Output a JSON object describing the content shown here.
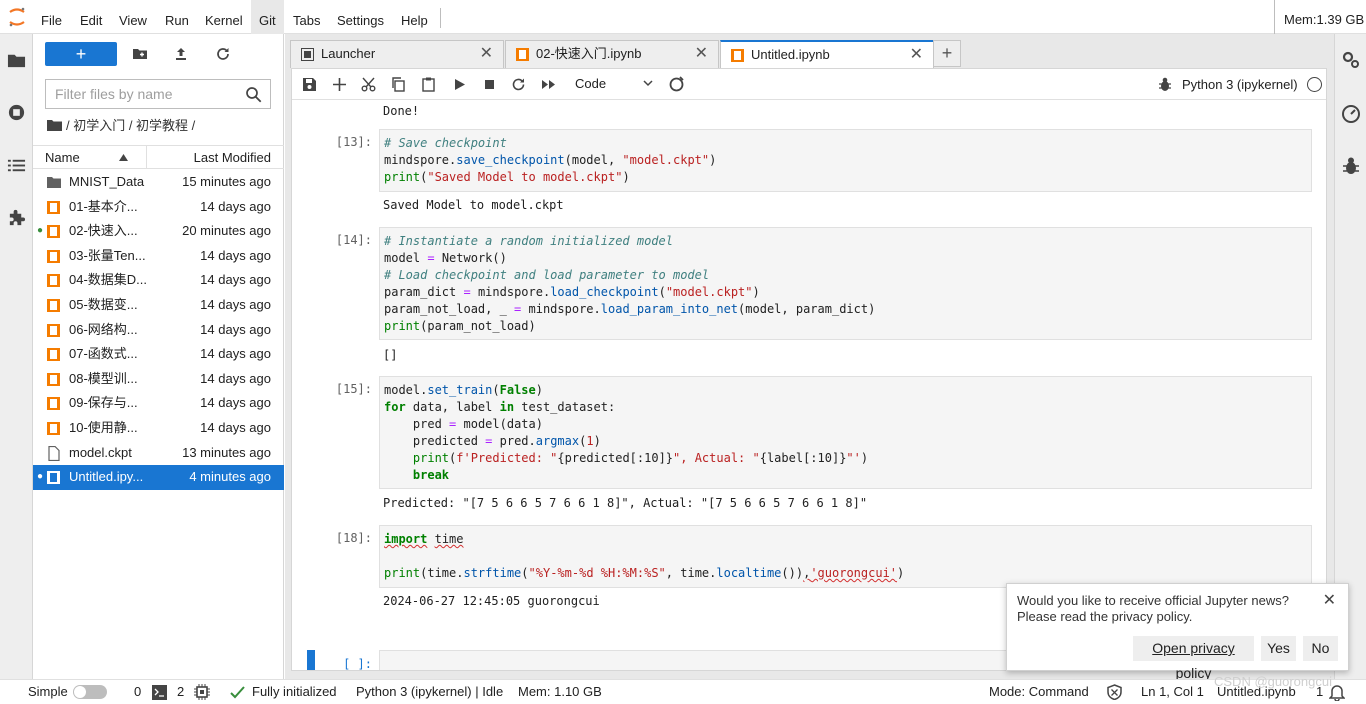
{
  "menubar": {
    "items": [
      "File",
      "Edit",
      "View",
      "Run",
      "Kernel",
      "Git",
      "Tabs",
      "Settings",
      "Help"
    ],
    "memory": "Mem:1.39 GB"
  },
  "filebrowser": {
    "new_label": "+",
    "filter_placeholder": "Filter files by name",
    "breadcrumb": "/ 初学入门 / 初学教程 /",
    "col_name": "Name",
    "col_modified": "Last Modified",
    "files": [
      {
        "name": "MNIST_Data",
        "modified": "15 minutes ago",
        "type": "folder",
        "running": false,
        "selected": false
      },
      {
        "name": "01-基本介...",
        "modified": "14 days ago",
        "type": "notebook",
        "running": false,
        "selected": false
      },
      {
        "name": "02-快速入...",
        "modified": "20 minutes ago",
        "type": "notebook",
        "running": true,
        "selected": false
      },
      {
        "name": "03-张量Ten...",
        "modified": "14 days ago",
        "type": "notebook",
        "running": false,
        "selected": false
      },
      {
        "name": "04-数据集D...",
        "modified": "14 days ago",
        "type": "notebook",
        "running": false,
        "selected": false
      },
      {
        "name": "05-数据变...",
        "modified": "14 days ago",
        "type": "notebook",
        "running": false,
        "selected": false
      },
      {
        "name": "06-网络构...",
        "modified": "14 days ago",
        "type": "notebook",
        "running": false,
        "selected": false
      },
      {
        "name": "07-函数式...",
        "modified": "14 days ago",
        "type": "notebook",
        "running": false,
        "selected": false
      },
      {
        "name": "08-模型训...",
        "modified": "14 days ago",
        "type": "notebook",
        "running": false,
        "selected": false
      },
      {
        "name": "09-保存与...",
        "modified": "14 days ago",
        "type": "notebook",
        "running": false,
        "selected": false
      },
      {
        "name": "10-使用静...",
        "modified": "14 days ago",
        "type": "notebook",
        "running": false,
        "selected": false
      },
      {
        "name": "model.ckpt",
        "modified": "13 minutes ago",
        "type": "file",
        "running": false,
        "selected": false
      },
      {
        "name": "Untitled.ipy...",
        "modified": "4 minutes ago",
        "type": "notebook",
        "running": true,
        "selected": true
      }
    ]
  },
  "tabs": [
    {
      "label": "Launcher",
      "icon": "launcher-icon",
      "active": false
    },
    {
      "label": "02-快速入门.ipynb",
      "icon": "notebook-icon",
      "active": false
    },
    {
      "label": "Untitled.ipynb",
      "icon": "notebook-icon",
      "active": true
    }
  ],
  "toolbar": {
    "cell_type": "Code",
    "kernel_name": "Python 3 (ipykernel)"
  },
  "cells": {
    "done_output": "Done!",
    "c13": {
      "prompt": "[13]:",
      "output": "Saved Model to model.ckpt"
    },
    "c14": {
      "prompt": "[14]:",
      "output": "[]"
    },
    "c15": {
      "prompt": "[15]:",
      "output": "Predicted: \"[7 5 6 6 5 7 6 6 1 8]\", Actual: \"[7 5 6 6 5 7 6 6 1 8]\""
    },
    "c18": {
      "prompt": "[18]:",
      "output": "2024-06-27 12:45:05 guorongcui"
    },
    "empty": {
      "prompt": "[ ]:"
    }
  },
  "toast": {
    "line1": "Would you like to receive official Jupyter news?",
    "line2": "Please read the privacy policy.",
    "open_label": "Open privacy policy",
    "yes_label": "Yes",
    "no_label": "No"
  },
  "statusbar": {
    "mode_simple": "Simple",
    "terminals": "0",
    "kernels": "2",
    "git_status": "Fully initialized",
    "kernel_status": "Python 3 (ipykernel) | Idle",
    "memory": "Mem: 1.10 GB",
    "command_mode": "Mode: Command",
    "cursor": "Ln 1, Col 1",
    "filename": "Untitled.ipynb",
    "notifications": "1"
  },
  "watermark": "CSDN @guorongcui",
  "colors": {
    "accent": "#1976d2",
    "notebook_orange": "#f57c00",
    "running_green": "#388e3c"
  }
}
